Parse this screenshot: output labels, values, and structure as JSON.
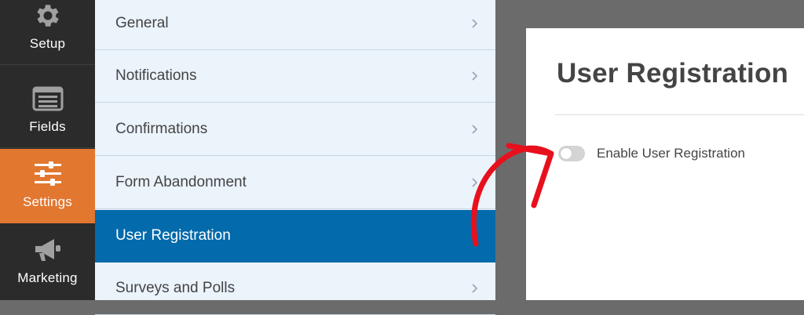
{
  "sidebar": {
    "items": [
      {
        "label": "Setup",
        "icon": "gear-icon",
        "active": false
      },
      {
        "label": "Fields",
        "icon": "fields-list-icon",
        "active": false
      },
      {
        "label": "Settings",
        "icon": "sliders-icon",
        "active": true
      },
      {
        "label": "Marketing",
        "icon": "megaphone-icon",
        "active": false
      }
    ]
  },
  "settings_panel": {
    "items": [
      {
        "label": "General",
        "active": false
      },
      {
        "label": "Notifications",
        "active": false
      },
      {
        "label": "Confirmations",
        "active": false
      },
      {
        "label": "Form Abandonment",
        "active": false
      },
      {
        "label": "User Registration",
        "active": true
      },
      {
        "label": "Surveys and Polls",
        "active": false
      }
    ]
  },
  "content": {
    "title": "User Registration",
    "toggle": {
      "label": "Enable User Registration",
      "enabled": false
    }
  },
  "colors": {
    "rail_bg": "#2b2b2b",
    "rail_active": "#e27730",
    "panel_bg": "#ebf3fb",
    "panel_active": "#036aab",
    "annotation_arrow": "#e8101d"
  }
}
